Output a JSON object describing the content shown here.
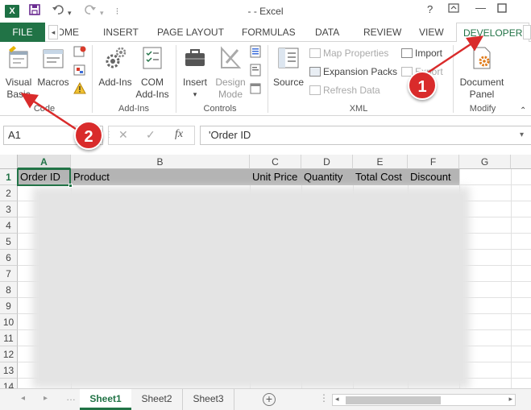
{
  "window": {
    "title": "- - Excel",
    "app_icon": "excel-logo",
    "help_label": "?",
    "buttons": [
      "restore-ribbon",
      "minimize",
      "maximize"
    ]
  },
  "ribbon_tabs": {
    "file": "FILE",
    "tabs": [
      "HOME",
      "INSERT",
      "PAGE LAYOUT",
      "FORMULAS",
      "DATA",
      "REVIEW",
      "VIEW"
    ],
    "active": "DEVELOPER"
  },
  "ribbon": {
    "code": {
      "visual_basic": "Visual\nBasic",
      "visual_basic_l1": "Visual",
      "visual_basic_l2": "Basic",
      "macros": "Macros",
      "group": "Code"
    },
    "addins": {
      "addins": "Add-Ins",
      "com_l1": "COM",
      "com_l2": "Add-Ins",
      "group": "Add-Ins"
    },
    "controls": {
      "insert": "Insert",
      "design_l1": "Design",
      "design_l2": "Mode",
      "group": "Controls"
    },
    "xml": {
      "source": "Source",
      "map_properties": "Map Properties",
      "expansion_packs": "Expansion Packs",
      "refresh_data": "Refresh Data",
      "import": "Import",
      "export": "Export",
      "group": "XML"
    },
    "modify": {
      "doc_l1": "Document",
      "doc_l2": "Panel",
      "group": "Modify"
    }
  },
  "formula_bar": {
    "name_box": "A1",
    "fx": "fx",
    "formula": "'Order ID"
  },
  "sheet": {
    "columns": [
      "A",
      "B",
      "C",
      "D",
      "E",
      "F",
      "G"
    ],
    "rows": [
      "1",
      "2",
      "3",
      "4",
      "5",
      "6",
      "7",
      "8",
      "9",
      "10",
      "11",
      "12",
      "13",
      "14"
    ],
    "headers": [
      "Order ID",
      "Product",
      "Unit Price",
      "Quantity",
      "Total Cost",
      "Discount"
    ]
  },
  "sheet_tabs": {
    "tabs": [
      "Sheet1",
      "Sheet2",
      "Sheet3"
    ],
    "active": "Sheet1"
  },
  "callouts": {
    "one": "1",
    "two": "2"
  },
  "colors": {
    "accent": "#217346",
    "callout": "#d92b2b",
    "header_fill": "#b4b4b4"
  }
}
